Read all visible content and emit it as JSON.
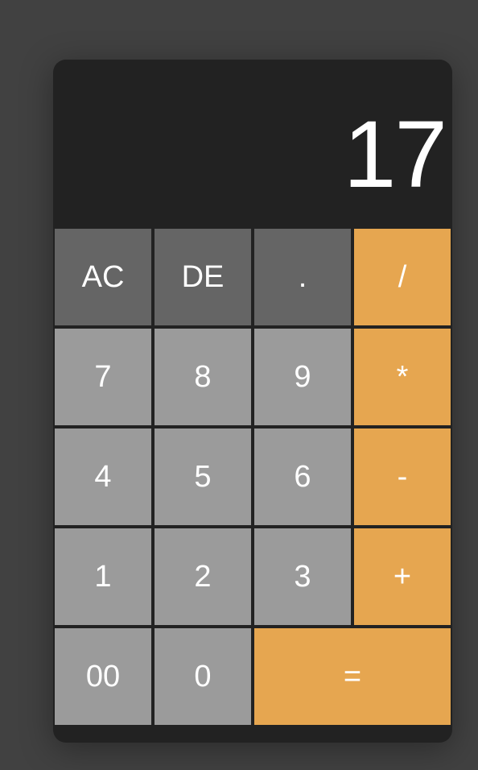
{
  "display": {
    "value": "17"
  },
  "keys": {
    "ac": "AC",
    "de": "DE",
    "dot": ".",
    "divide": "/",
    "seven": "7",
    "eight": "8",
    "nine": "9",
    "multiply": "*",
    "four": "4",
    "five": "5",
    "six": "6",
    "minus": "-",
    "one": "1",
    "two": "2",
    "three": "3",
    "plus": "+",
    "double_zero": "00",
    "zero": "0",
    "equals": "="
  },
  "colors": {
    "background": "#414141",
    "calculator_body": "#222222",
    "function_key": "#656565",
    "number_key": "#9b9b9b",
    "operator_key": "#e6a650",
    "text": "#ffffff"
  }
}
